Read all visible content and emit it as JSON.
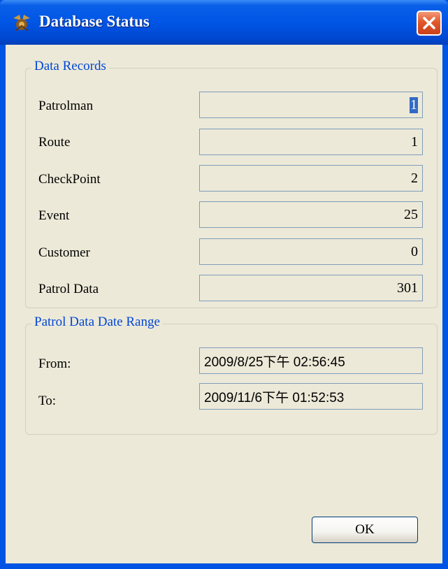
{
  "window": {
    "title": "Database Status",
    "icon": "patrol-app-icon",
    "close_icon": "close-icon"
  },
  "colors": {
    "titlebar": "#0055e5",
    "client_bg": "#ece9d8",
    "group_title": "#0046d5",
    "field_border": "#7f9db9",
    "close_button": "#e2582c"
  },
  "data_records": {
    "title": "Data Records",
    "rows": [
      {
        "label": "Patrolman",
        "value": "1"
      },
      {
        "label": "Route",
        "value": "1"
      },
      {
        "label": "CheckPoint",
        "value": "2"
      },
      {
        "label": "Event",
        "value": "25"
      },
      {
        "label": "Customer",
        "value": "0"
      },
      {
        "label": "Patrol Data",
        "value": "301"
      }
    ]
  },
  "date_range": {
    "title": "Patrol Data Date Range",
    "from_label": "From:",
    "from_value": "2009/8/25下午 02:56:45",
    "to_label": "To:",
    "to_value": "2009/11/6下午 01:52:53"
  },
  "buttons": {
    "ok_label": "OK"
  }
}
